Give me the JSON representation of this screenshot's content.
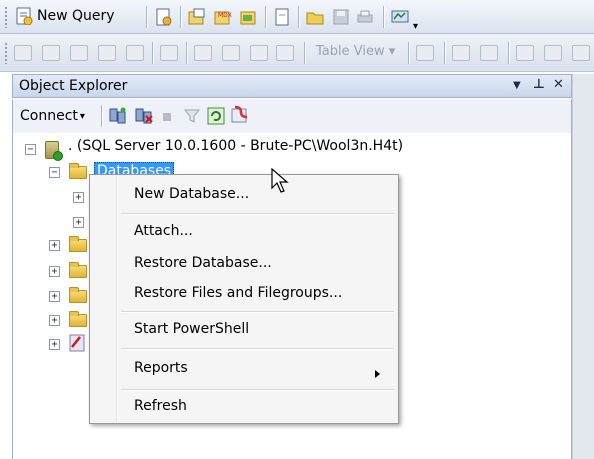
{
  "toolbar": {
    "new_query_label": "New Query",
    "icons": [
      "new-query-icon",
      "database-engine-query-icon",
      "analysis-query-icon",
      "mdx-query-icon",
      "xml-query-icon",
      "new-file-icon",
      "open-file-icon",
      "save-icon",
      "print-icon",
      "activity-monitor-icon"
    ],
    "table_view_label": "Table View",
    "table_view_dropdown": "▾"
  },
  "object_explorer": {
    "title": "Object Explorer",
    "pin_glyph": "▾ ⊥ ✕",
    "connect_label": "Connect",
    "connect_dropdown": "▾",
    "toolbar_icons": [
      "connect-object-icon",
      "disconnect-icon",
      "stop-icon",
      "filter-icon",
      "refresh-icon",
      "start-powershell-icon"
    ]
  },
  "tree": {
    "server_label": ". (SQL Server 10.0.1600 - Brute-PC\\Wool3n.H4t)",
    "databases_label": "Databases",
    "collapse_glyph": "−",
    "expand_glyph": "+"
  },
  "context_menu": {
    "items": [
      {
        "label": "New Database..."
      },
      {
        "label": "Attach..."
      },
      {
        "label": "Restore Database..."
      },
      {
        "label": "Restore Files and Filegroups..."
      },
      {
        "label": "Start PowerShell"
      },
      {
        "label": "Reports",
        "submenu": true
      },
      {
        "label": "Refresh"
      }
    ]
  },
  "colors": {
    "selection": "#3399ff",
    "panel_header": "#c9d6ea"
  }
}
